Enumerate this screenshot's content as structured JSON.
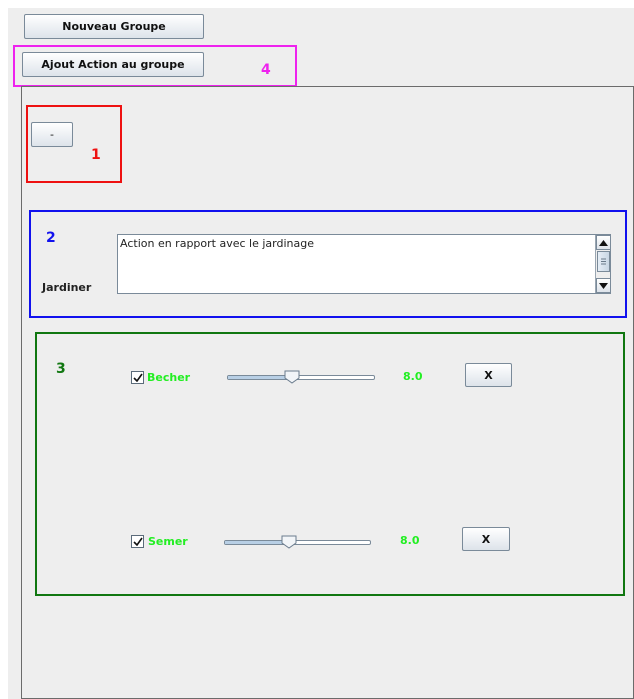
{
  "colors": {
    "annotation_1": "#ee1111",
    "annotation_2": "#1111ee",
    "annotation_3": "#117711",
    "annotation_4": "#ee22ee",
    "action_label": "#22ee22"
  },
  "toolbar": {
    "new_group_label": "Nouveau Groupe",
    "add_action_label": "Ajout Action au groupe"
  },
  "annotations": {
    "a1": "1",
    "a2": "2",
    "a3": "3",
    "a4": "4"
  },
  "group": {
    "collapse_label": "-",
    "name": "Jardiner",
    "description": "Action en rapport avec le jardinage"
  },
  "actions": [
    {
      "label": "Becher",
      "checked": true,
      "level": 8.0,
      "value_text": "8.0",
      "remove_label": "X"
    },
    {
      "label": "Semer",
      "checked": true,
      "level": 8.0,
      "value_text": "8.0",
      "remove_label": "X"
    }
  ],
  "icons": {
    "scroll_up": "scroll-up-arrow-icon",
    "scroll_down": "scroll-down-arrow-icon",
    "checkbox": "checkmark-icon",
    "slider": "slider-thumb-icon"
  }
}
